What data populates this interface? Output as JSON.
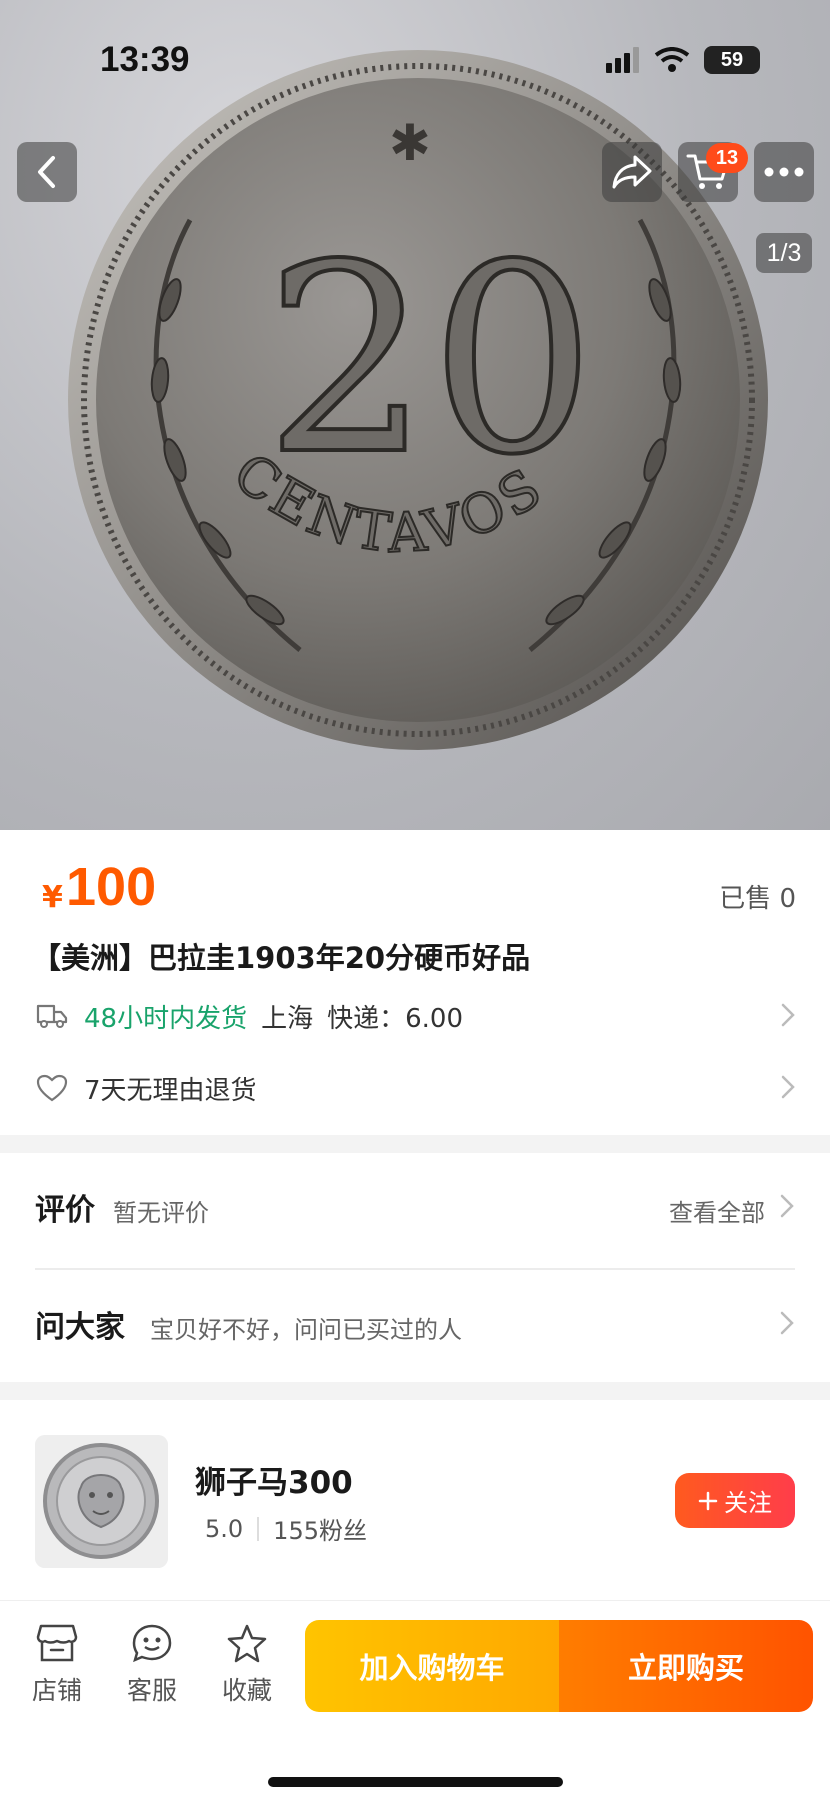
{
  "status_bar": {
    "time": "13:39",
    "battery": "59"
  },
  "gallery": {
    "page_indicator": "1/3",
    "cart_count": "13",
    "coin_text_number": "20",
    "coin_text_word": "CENTAVOS"
  },
  "product": {
    "price_symbol": "¥",
    "price": "100",
    "sold": "已售 0",
    "title": "【美洲】巴拉圭1903年20分硬币好品",
    "shipping_highlight": "48小时内发货",
    "shipping_location": "上海",
    "shipping_fee": "快递：6.00",
    "return_policy": "7天无理由退货"
  },
  "reviews": {
    "title": "评价",
    "summary": "暂无评价",
    "view_all": "查看全部"
  },
  "ask": {
    "title": "问大家",
    "prompt": "宝贝好不好，问问已买过的人"
  },
  "shop": {
    "name": "狮子马300",
    "rating": "5.0",
    "followers": "155粉丝",
    "follow_label": "关注"
  },
  "bottom_bar": {
    "store_label": "店铺",
    "service_label": "客服",
    "favorite_label": "收藏",
    "add_to_cart_label": "加入购物车",
    "buy_now_label": "立即购买"
  },
  "colors": {
    "price": "#ff5a00",
    "shipping": "#19a36b",
    "cart_button": "#ffb400",
    "buy_button": "#ff6200"
  }
}
